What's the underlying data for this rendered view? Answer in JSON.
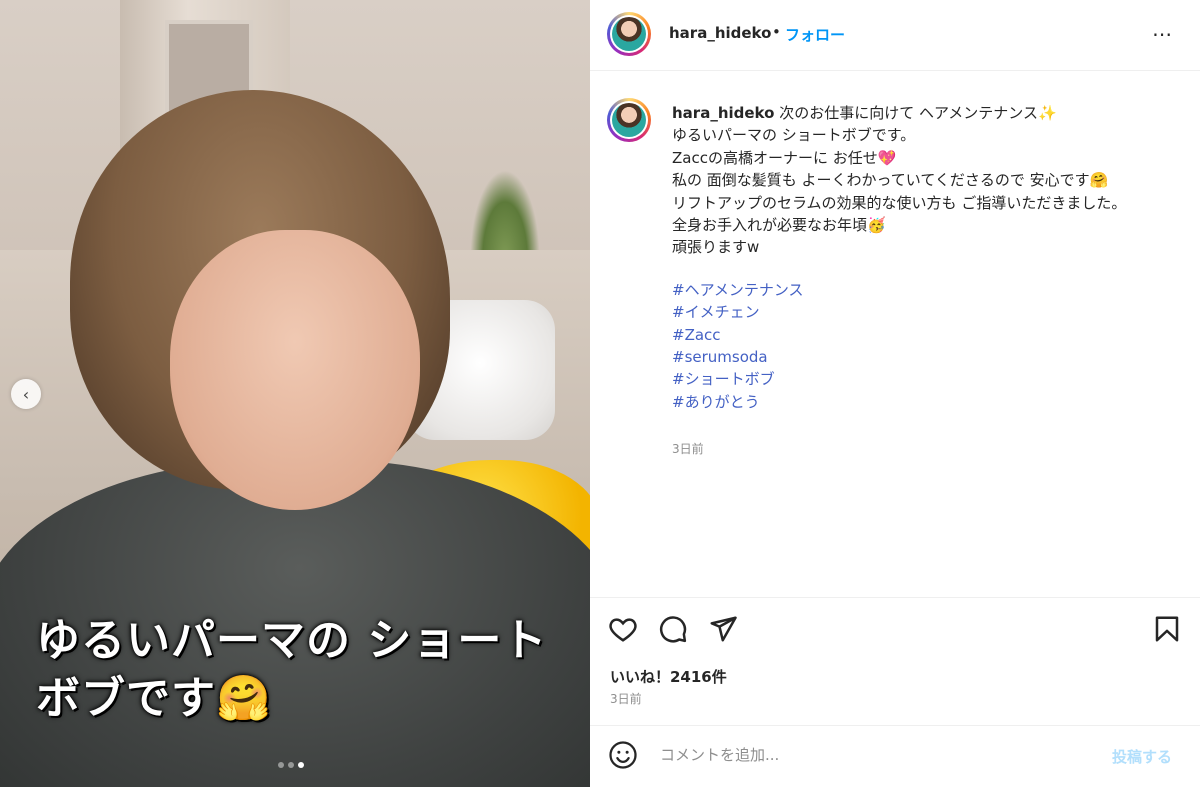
{
  "post": {
    "username": "hara_hideko",
    "separator": "•",
    "follow_label": "フォロー",
    "more_icon": "⋯",
    "image_overlay_text": "ゆるいパーマの ショートボブです🤗",
    "slide_count": 3,
    "active_slide": 3
  },
  "caption": {
    "username": "hara_hideko",
    "lines": [
      "次のお仕事に向けて ヘアメンテナンス✨",
      "ゆるいパーマの ショートボブです。",
      "Zaccの高橋オーナーに お任せ💖",
      "私の 面倒な髪質も よーくわかっていてくださるので 安心です🤗",
      "リフトアップのセラムの効果的な使い方も ご指導いただきました。",
      "全身お手入れが必要なお年頃🥳",
      "頑張りますw"
    ],
    "hashtags": [
      "#ヘアメンテナンス",
      "#イメチェン",
      "#Zacc",
      "#serumsoda",
      "#ショートボブ",
      "#ありがとう"
    ],
    "time": "3日前"
  },
  "engagement": {
    "likes_text": "いいね！2416件",
    "time": "3日前"
  },
  "comment": {
    "placeholder": "コメントを追加...",
    "post_label": "投稿する"
  },
  "colors": {
    "link": "#0095f6",
    "hashtag": "#4461c4",
    "muted": "#8e8e8e"
  }
}
